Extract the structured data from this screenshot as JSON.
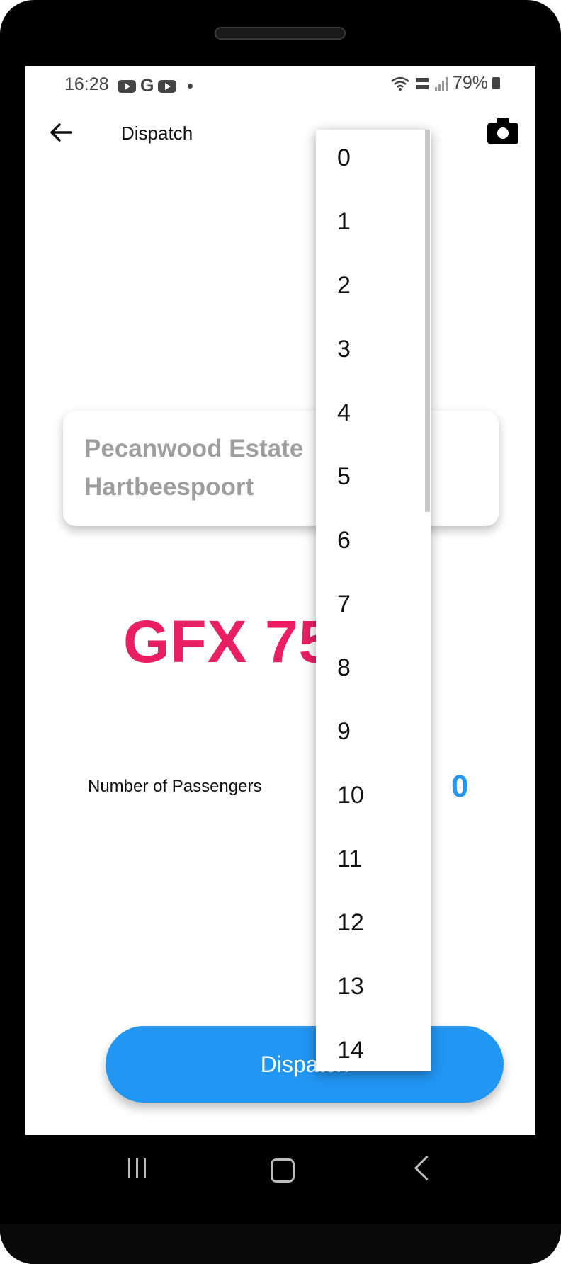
{
  "status_bar": {
    "time": "16:28",
    "notification_icons": [
      "youtube-icon",
      "google-icon",
      "youtube-icon",
      "dot-icon"
    ],
    "google_letter": "G",
    "battery": "79%",
    "system_icons": [
      "wifi-icon",
      "volte-icon",
      "signal-icon",
      "battery-icon"
    ]
  },
  "app_bar": {
    "title": "Dispatch",
    "back_icon": "arrow-left-icon",
    "camera_icon": "camera-icon"
  },
  "location_card": {
    "line1": "Pecanwood Estate",
    "line2": "Hartbeespoort"
  },
  "vehicle": {
    "plate": "GFX 75"
  },
  "passengers": {
    "label": "Number of Passengers",
    "value": "0"
  },
  "dispatch_button": {
    "label": "Dispatch"
  },
  "dropdown": {
    "options": [
      "0",
      "1",
      "2",
      "3",
      "4",
      "5",
      "6",
      "7",
      "8",
      "9",
      "10",
      "11",
      "12",
      "13",
      "14"
    ]
  },
  "colors": {
    "accent": "#2196f3",
    "plate": "#e91e63",
    "card_text": "#9e9e9e"
  }
}
